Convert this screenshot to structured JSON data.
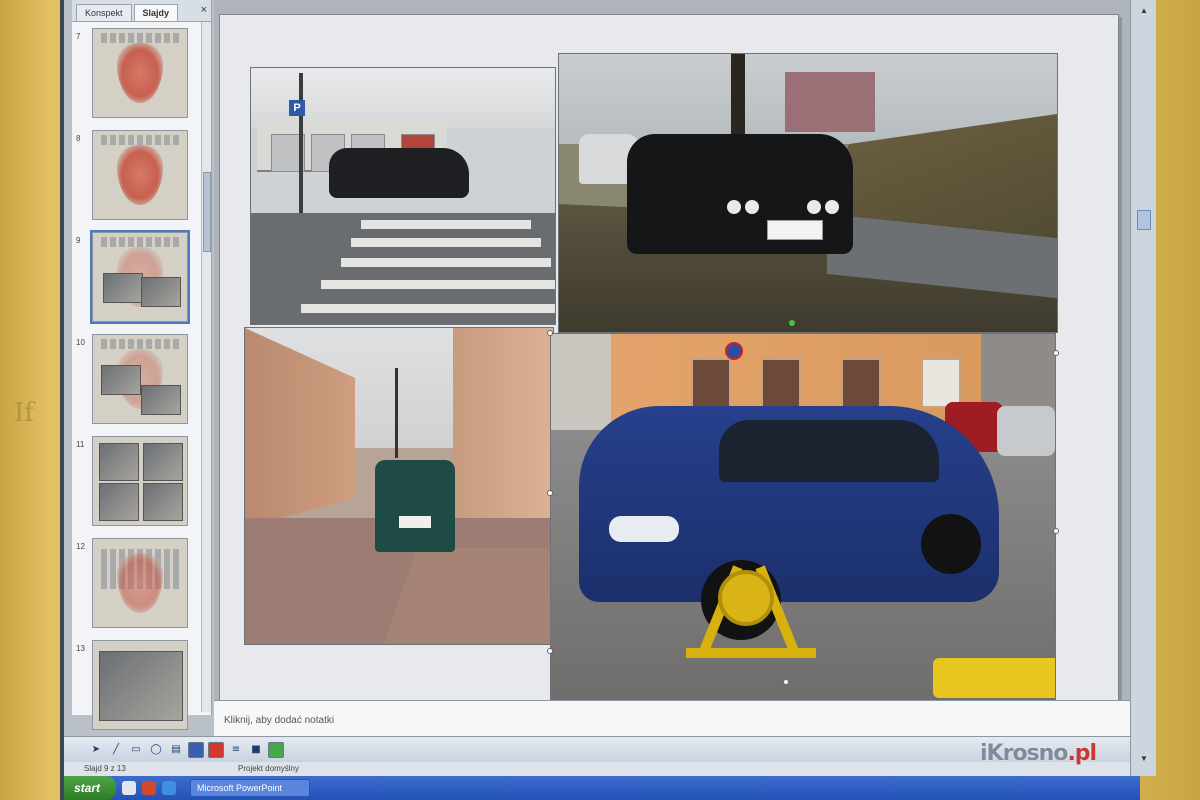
{
  "pane": {
    "tab_outline": "Konspekt",
    "tab_slides": "Slajdy",
    "close_glyph": "×",
    "slides": [
      {
        "num": "7"
      },
      {
        "num": "8"
      },
      {
        "num": "9"
      },
      {
        "num": "10"
      },
      {
        "num": "11"
      },
      {
        "num": "12"
      },
      {
        "num": "13"
      }
    ]
  },
  "photos": {
    "p1_sign": "P"
  },
  "notes": {
    "placeholder": "Kliknij, aby dodać notatki"
  },
  "statusbar": {
    "slide": "Slajd 9 z 13",
    "design": "Projekt domyślny"
  },
  "taskbar": {
    "start": "start",
    "task": "Microsoft PowerPoint"
  },
  "watermark": {
    "brand": "iKrosno",
    "tld": ".pl"
  },
  "colors": {
    "accent": "#2352b8",
    "bezel": "#dcb955"
  },
  "icons": [
    "start-icon",
    "close-icon",
    "arrow-icon",
    "line-icon",
    "rectangle-icon",
    "oval-icon",
    "text-box-icon",
    "fill-color-icon",
    "font-color-icon",
    "line-style-icon",
    "shadow-icon"
  ]
}
